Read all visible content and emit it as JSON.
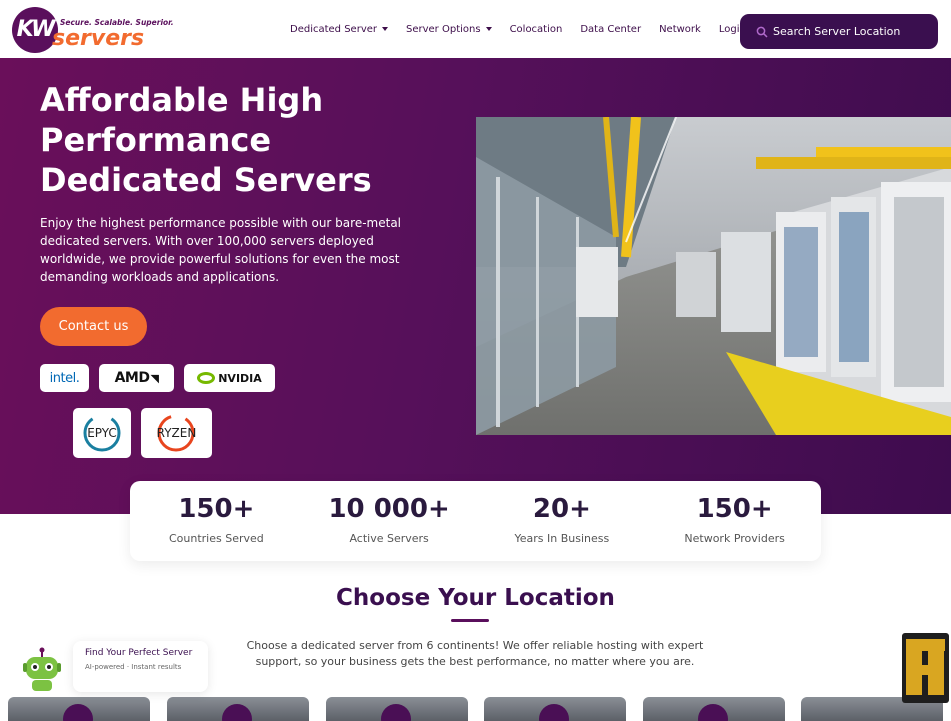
{
  "header": {
    "logo_badge": "KW",
    "logo_tagline": "Secure. Scalable. Superior.",
    "logo_word": "servers",
    "nav": [
      {
        "label": "Dedicated Server",
        "dropdown": true
      },
      {
        "label": "Server Options",
        "dropdown": true
      },
      {
        "label": "Colocation",
        "dropdown": false
      },
      {
        "label": "Data Center",
        "dropdown": false
      },
      {
        "label": "Network",
        "dropdown": false
      },
      {
        "label": "Login",
        "dropdown": false
      }
    ],
    "search_label": "Search Server Location"
  },
  "hero": {
    "title": "Affordable High Performance Dedicated Servers",
    "description": "Enjoy the highest performance possible with our bare-metal dedicated servers. With over 100,000 servers deployed worldwide, we provide powerful solutions for even the most demanding workloads and applications.",
    "cta_label": "Contact us",
    "brands": {
      "intel": "intel.",
      "amd": "AMD",
      "nvidia": "NVIDIA",
      "epyc": "EPYC",
      "ryzen": "RYZEN"
    }
  },
  "stats": [
    {
      "value": "150+",
      "label": "Countries Served"
    },
    {
      "value": "10 000+",
      "label": "Active Servers"
    },
    {
      "value": "20+",
      "label": "Years In Business"
    },
    {
      "value": "150+",
      "label": "Network Providers"
    }
  ],
  "location": {
    "title": "Choose Your Location",
    "description": "Choose a dedicated server from 6 continents! We offer reliable hosting with expert support, so your business gets the best performance, no matter where you are."
  },
  "chat": {
    "title": "Find Your Perfect Server",
    "subtitle": "AI-powered · Instant results"
  },
  "colors": {
    "primary": "#3a0f4f",
    "accent": "#f26b2f",
    "hero_start": "#6a0f5a",
    "hero_end": "#3e0c4e"
  }
}
